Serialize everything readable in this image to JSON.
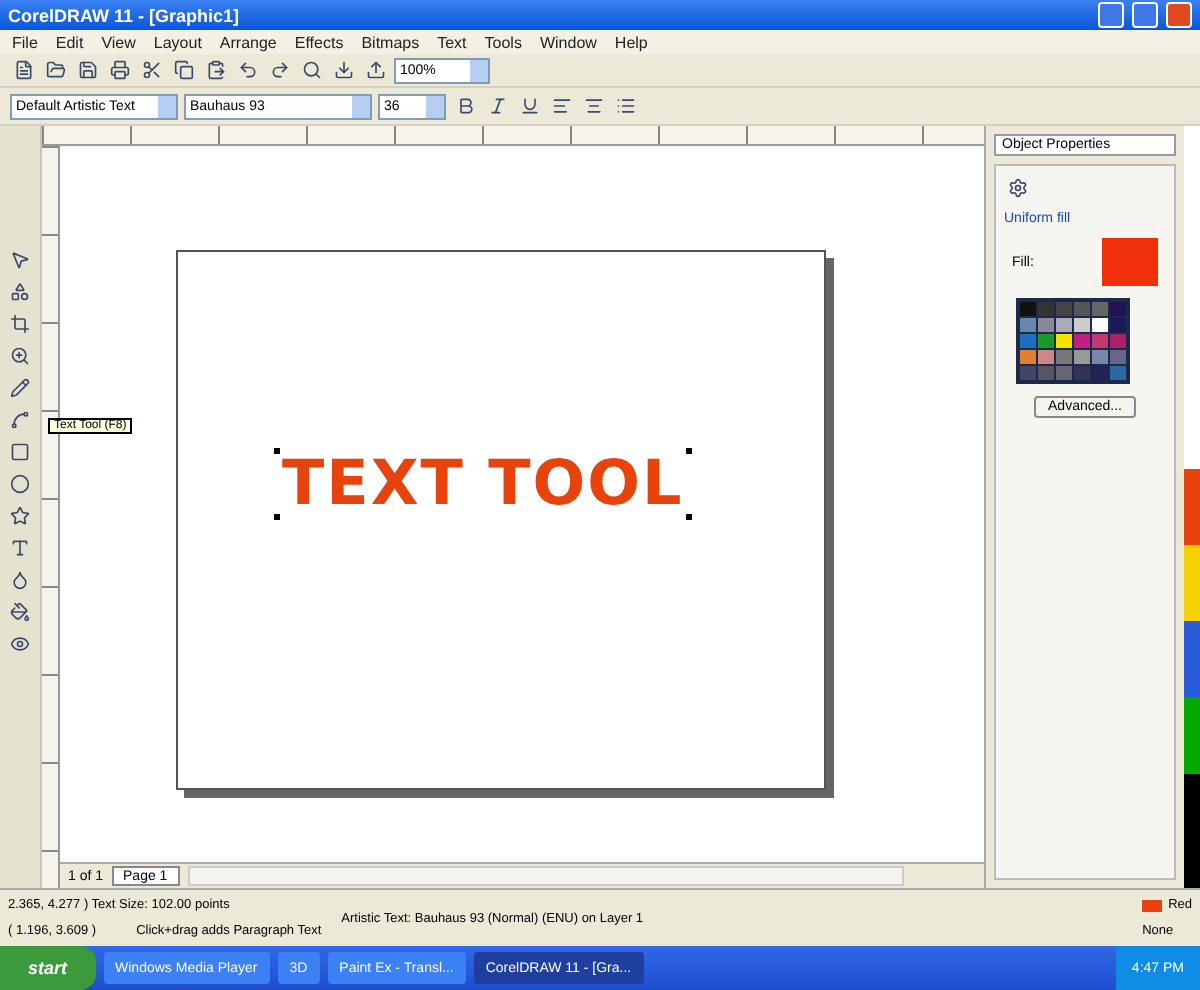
{
  "window": {
    "title": "CorelDRAW 11 - [Graphic1]"
  },
  "menu": [
    "File",
    "Edit",
    "View",
    "Layout",
    "Arrange",
    "Effects",
    "Bitmaps",
    "Text",
    "Tools",
    "Window",
    "Help"
  ],
  "toolbar": {
    "zoom": "100%"
  },
  "property_bar": {
    "style": "Default Artistic Text",
    "font": "Bauhaus 93",
    "size": "36"
  },
  "canvas": {
    "text": "TEXT TOOL",
    "tooltip": "Text Tool (F8)"
  },
  "docker": {
    "title": "Object Properties",
    "section": "Uniform fill",
    "fill_label": "Fill:",
    "button": "Advanced..."
  },
  "page_nav": {
    "counter": "1 of 1",
    "tabs": [
      {
        "label": "Page 1",
        "selected": true
      }
    ]
  },
  "status_bar": {
    "line_1": "2.365, 4.277 )  Text Size: 102.00 points",
    "line_2": "( 1.196, 3.609 )",
    "hint": "Click+drag adds Paragraph Text",
    "object": "Artistic Text: Bauhaus 93 (Normal) (ENU) on Layer 1",
    "fill": "Red",
    "outline": "None"
  },
  "taskbar": {
    "start": "start",
    "items": [
      {
        "label": "Windows Media Player",
        "selected": false
      },
      {
        "label": "3D",
        "selected": false
      },
      {
        "label": "Paint Ex - Transl...",
        "selected": false
      },
      {
        "label": "CorelDRAW 11 - [Gra...",
        "selected": true
      }
    ],
    "clock": "4:47 PM"
  }
}
